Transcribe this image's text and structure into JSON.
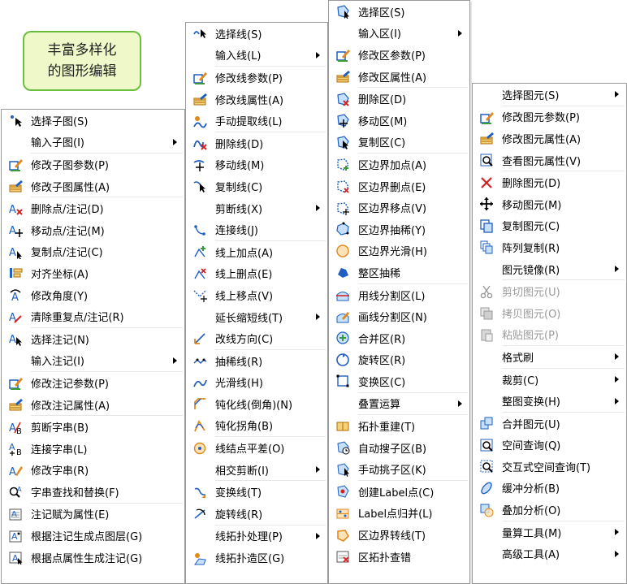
{
  "badge": {
    "line1": "丰富多样化",
    "line2": "的图形编辑"
  },
  "colors": {
    "accent_blue": "#1f5fbf",
    "accent_orange": "#e08a1e",
    "accent_red": "#d42020",
    "accent_green": "#3a9a3a",
    "badge_border": "#6abf3e",
    "badge_fill": "#eef8c9"
  },
  "menu1": [
    {
      "label": "选择子图(S)",
      "icon": "select-sub-icon"
    },
    {
      "label": "输入子图(I)",
      "icon": "none",
      "submenu": true,
      "sep": true
    },
    {
      "label": "修改子图参数(P)",
      "icon": "edit-params-icon"
    },
    {
      "label": "修改子图属性(A)",
      "icon": "edit-attr-icon",
      "sep": true
    },
    {
      "label": "删除点/注记(D)",
      "icon": "delete-point-icon"
    },
    {
      "label": "移动点/注记(M)",
      "icon": "move-point-icon"
    },
    {
      "label": "复制点/注记(C)",
      "icon": "copy-point-icon"
    },
    {
      "label": "对齐坐标(A)",
      "icon": "align-icon"
    },
    {
      "label": "修改角度(Y)",
      "icon": "angle-icon"
    },
    {
      "label": "清除重复点/注记(R)",
      "icon": "clear-dup-icon",
      "sep": true
    },
    {
      "label": "选择注记(N)",
      "icon": "select-note-icon"
    },
    {
      "label": "输入注记(I)",
      "icon": "none",
      "submenu": true,
      "sep": true
    },
    {
      "label": "修改注记参数(P)",
      "icon": "edit-params-icon"
    },
    {
      "label": "修改注记属性(A)",
      "icon": "edit-attr-icon",
      "sep": true
    },
    {
      "label": "剪断字串(B)",
      "icon": "cut-string-icon"
    },
    {
      "label": "连接字串(L)",
      "icon": "join-string-icon"
    },
    {
      "label": "修改字串(R)",
      "icon": "edit-string-icon"
    },
    {
      "label": "字串查找和替换(F)",
      "icon": "find-replace-icon",
      "sep": true
    },
    {
      "label": "注记赋为属性(E)",
      "icon": "note-to-attr-icon"
    },
    {
      "label": "根据注记生成点图层(G)",
      "icon": "note-to-layer-icon"
    },
    {
      "label": "根据点属性生成注记(G)",
      "icon": "attr-to-note-icon"
    }
  ],
  "menu2": [
    {
      "label": "选择线(S)",
      "icon": "select-line-icon"
    },
    {
      "label": "输入线(L)",
      "icon": "none",
      "submenu": true,
      "sep": true
    },
    {
      "label": "修改线参数(P)",
      "icon": "edit-params-icon"
    },
    {
      "label": "修改线属性(A)",
      "icon": "edit-attr-icon"
    },
    {
      "label": "手动提取线(L)",
      "icon": "extract-line-icon",
      "sep": true
    },
    {
      "label": "删除线(D)",
      "icon": "delete-line-icon"
    },
    {
      "label": "移动线(M)",
      "icon": "move-line-icon"
    },
    {
      "label": "复制线(C)",
      "icon": "copy-line-icon"
    },
    {
      "label": "剪断线(X)",
      "icon": "none",
      "submenu": true
    },
    {
      "label": "连接线(J)",
      "icon": "join-line-icon",
      "sep": true
    },
    {
      "label": "线上加点(A)",
      "icon": "add-vertex-icon"
    },
    {
      "label": "线上删点(E)",
      "icon": "del-vertex-icon"
    },
    {
      "label": "线上移点(V)",
      "icon": "move-vertex-icon"
    },
    {
      "label": "延长缩短线(T)",
      "icon": "none",
      "submenu": true
    },
    {
      "label": "改线方向(C)",
      "icon": "reverse-icon",
      "sep": true
    },
    {
      "label": "抽稀线(R)",
      "icon": "thin-icon"
    },
    {
      "label": "光滑线(H)",
      "icon": "smooth-icon"
    },
    {
      "label": "钝化线(倒角)(N)",
      "icon": "chamfer-icon"
    },
    {
      "label": "钝化拐角(B)",
      "icon": "blunt-icon",
      "sep": true
    },
    {
      "label": "线结点平差(O)",
      "icon": "node-adjust-icon"
    },
    {
      "label": "相交剪断(I)",
      "icon": "none",
      "submenu": true,
      "sep": true
    },
    {
      "label": "变换线(T)",
      "icon": "transform-icon"
    },
    {
      "label": "旋转线(R)",
      "icon": "rotate-icon",
      "sep": true
    },
    {
      "label": "线拓扑处理(P)",
      "icon": "none",
      "submenu": true
    },
    {
      "label": "线拓扑造区(G)",
      "icon": "topo-area-icon"
    }
  ],
  "menu3": [
    {
      "label": "选择区(S)",
      "icon": "select-area-icon"
    },
    {
      "label": "输入区(I)",
      "icon": "none",
      "submenu": true
    },
    {
      "label": "修改区参数(P)",
      "icon": "edit-params-icon"
    },
    {
      "label": "修改区属性(A)",
      "icon": "edit-attr-icon",
      "sep": true
    },
    {
      "label": "删除区(D)",
      "icon": "delete-area-icon"
    },
    {
      "label": "移动区(M)",
      "icon": "move-area-icon"
    },
    {
      "label": "复制区(C)",
      "icon": "copy-area-icon",
      "sep": true
    },
    {
      "label": "区边界加点(A)",
      "icon": "area-add-vertex-icon"
    },
    {
      "label": "区边界删点(E)",
      "icon": "area-del-vertex-icon"
    },
    {
      "label": "区边界移点(V)",
      "icon": "area-move-vertex-icon"
    },
    {
      "label": "区边界抽稀(Y)",
      "icon": "area-thin-icon"
    },
    {
      "label": "区边界光滑(H)",
      "icon": "area-smooth-icon"
    },
    {
      "label": "整区抽稀",
      "icon": "whole-thin-icon",
      "sep": true
    },
    {
      "label": "用线分割区(L)",
      "icon": "split-line-icon"
    },
    {
      "label": "画线分割区(N)",
      "icon": "split-draw-icon"
    },
    {
      "label": "合并区(R)",
      "icon": "merge-area-icon"
    },
    {
      "label": "旋转区(R)",
      "icon": "rotate-area-icon"
    },
    {
      "label": "变换区(C)",
      "icon": "transform-area-icon",
      "sep": true
    },
    {
      "label": "叠置运算",
      "icon": "none",
      "submenu": true,
      "sep": true
    },
    {
      "label": "拓扑重建(T)",
      "icon": "topo-rebuild-icon"
    },
    {
      "label": "自动搜子区(B)",
      "icon": "auto-sub-icon"
    },
    {
      "label": "手动挑子区(K)",
      "icon": "manual-sub-icon",
      "sep": true
    },
    {
      "label": "创建Label点(C)",
      "icon": "create-label-icon"
    },
    {
      "label": "Label点归并(L)",
      "icon": "label-merge-icon"
    },
    {
      "label": "区边界转线(T)",
      "icon": "boundary-to-line-icon"
    },
    {
      "label": "区拓扑查错",
      "icon": "topo-check-icon"
    }
  ],
  "menu4": [
    {
      "label": "选择图元(S)",
      "icon": "none",
      "submenu": true,
      "sep": true
    },
    {
      "label": "修改图元参数(P)",
      "icon": "edit-params-icon"
    },
    {
      "label": "修改图元属性(A)",
      "icon": "edit-attr-icon"
    },
    {
      "label": "查看图元属性(V)",
      "icon": "view-attr-icon",
      "sep": true
    },
    {
      "label": "删除图元(D)",
      "icon": "delete-icon"
    },
    {
      "label": "移动图元(M)",
      "icon": "move-icon"
    },
    {
      "label": "复制图元(C)",
      "icon": "copy-icon"
    },
    {
      "label": "阵列复制(R)",
      "icon": "array-copy-icon"
    },
    {
      "label": "图元镜像(R)",
      "icon": "none",
      "submenu": true,
      "sep": true
    },
    {
      "label": "剪切图元(U)",
      "icon": "scissors-icon",
      "disabled": true
    },
    {
      "label": "拷贝图元(O)",
      "icon": "copy-disabled-icon",
      "disabled": true
    },
    {
      "label": "粘贴图元(P)",
      "icon": "paste-icon",
      "disabled": true,
      "sep": true
    },
    {
      "label": "格式刷",
      "icon": "none",
      "submenu": true,
      "sep": true
    },
    {
      "label": "裁剪(C)",
      "icon": "none",
      "submenu": true
    },
    {
      "label": "整图变换(H)",
      "icon": "none",
      "submenu": true,
      "sep": true
    },
    {
      "label": "合并图元(U)",
      "icon": "merge-icon"
    },
    {
      "label": "空间查询(Q)",
      "icon": "spatial-query-icon"
    },
    {
      "label": "交互式空间查询(T)",
      "icon": "interactive-query-icon"
    },
    {
      "label": "缓冲分析(B)",
      "icon": "buffer-icon"
    },
    {
      "label": "叠加分析(O)",
      "icon": "overlay-icon",
      "sep": true
    },
    {
      "label": "量算工具(M)",
      "icon": "none",
      "submenu": true
    },
    {
      "label": "高级工具(A)",
      "icon": "none",
      "submenu": true
    }
  ]
}
